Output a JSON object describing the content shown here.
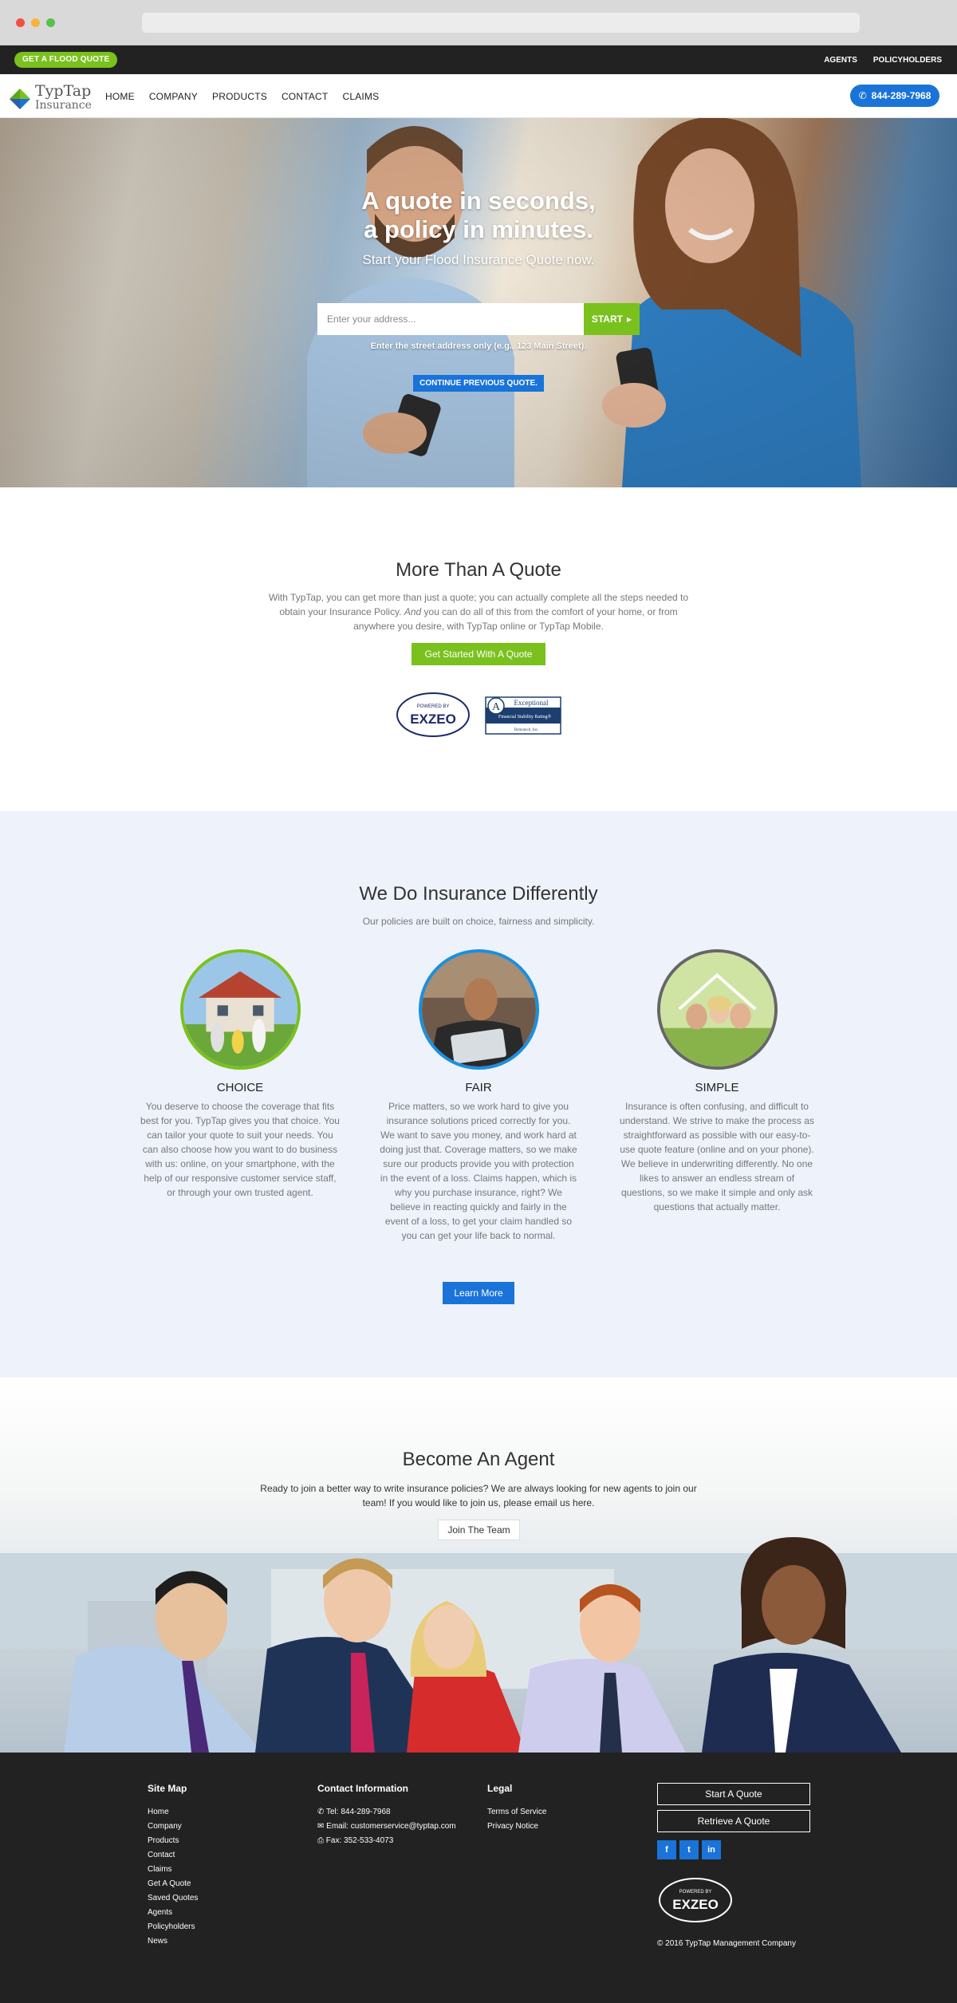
{
  "topbar": {
    "flood_quote": "GET A FLOOD QUOTE",
    "agents": "AGENTS",
    "policyholders": "POLICYHOLDERS"
  },
  "nav": {
    "logo_line1": "TypTap",
    "logo_line2": "Insurance",
    "items": [
      "HOME",
      "COMPANY",
      "PRODUCTS",
      "CONTACT",
      "CLAIMS"
    ],
    "phone": "844-289-7968"
  },
  "hero": {
    "title_line1": "A quote in seconds,",
    "title_line2": "a policy in minutes.",
    "subtitle": "Start your Flood Insurance Quote now.",
    "address_placeholder": "Enter your address...",
    "start_label": "START",
    "hint": "Enter the street address only (e.g., 123 Main Street).",
    "continue_label": "CONTINUE PREVIOUS QUOTE."
  },
  "more": {
    "title": "More Than A Quote",
    "text_before": "With TypTap, you can get more than just a quote; you can actually complete all the steps needed to obtain your Insurance Policy. ",
    "text_em": "And",
    "text_after": " you can do all of this from the comfort of your home, or from anywhere you desire, with TypTap online or TypTap Mobile.",
    "button": "Get Started With A Quote",
    "exzeo_small": "POWERED BY",
    "exzeo_big": "EXZEO",
    "demotech_a": "A",
    "demotech_title": "Exceptional",
    "demotech_line": "Financial Stability Rating®",
    "demotech_by": "Demotech, Inc."
  },
  "different": {
    "title": "We Do Insurance Differently",
    "subtitle": "Our policies are built on choice, fairness and simplicity.",
    "columns": [
      {
        "title": "CHOICE",
        "text": "You deserve to choose the coverage that fits best for you. TypTap gives you that choice. You can tailor your quote to suit your needs. You can also choose how you want to do business with us: online, on your smartphone, with the help of our responsive customer service staff, or through your own trusted agent."
      },
      {
        "title": "FAIR",
        "text": "Price matters, so we work hard to give you insurance solutions priced correctly for you. We want to save you money, and work hard at doing just that. Coverage matters, so we make sure our products provide you with protection in the event of a loss. Claims happen, which is why you purchase insurance, right? We believe in reacting quickly and fairly in the event of a loss, to get your claim handled so you can get your life back to normal."
      },
      {
        "title": "SIMPLE",
        "text": "Insurance is often confusing, and difficult to understand. We strive to make the process as straightforward as possible with our easy-to-use quote feature (online and on your phone). We believe in underwriting differently. No one likes to answer an endless stream of questions, so we make it simple and only ask questions that actually matter."
      }
    ],
    "button": "Learn More"
  },
  "agent": {
    "title": "Become An Agent",
    "text": "Ready to join a better way to write insurance policies? We are always looking for new agents to join our team! If you would like to join us, please email us here.",
    "button": "Join The Team"
  },
  "footer": {
    "sitemap_title": "Site Map",
    "sitemap": [
      "Home",
      "Company",
      "Products",
      "Contact",
      "Claims",
      "Get A Quote",
      "Saved Quotes",
      "Agents",
      "Policyholders",
      "News"
    ],
    "contact_title": "Contact Information",
    "tel": "Tel: 844-289-7968",
    "email": "Email: customerservice@typtap.com",
    "fax": "Fax: 352-533-4073",
    "legal_title": "Legal",
    "legal": [
      "Terms of Service",
      "Privacy Notice"
    ],
    "start_quote": "Start A Quote",
    "retrieve_quote": "Retrieve A Quote",
    "social": [
      "f",
      "t",
      "in"
    ],
    "copyright": "© 2016 TypTap Management Company"
  },
  "colors": {
    "green": "#7ac11e",
    "blue": "#1a73d9",
    "dark": "#222222",
    "section_bg": "#eef2fb"
  }
}
